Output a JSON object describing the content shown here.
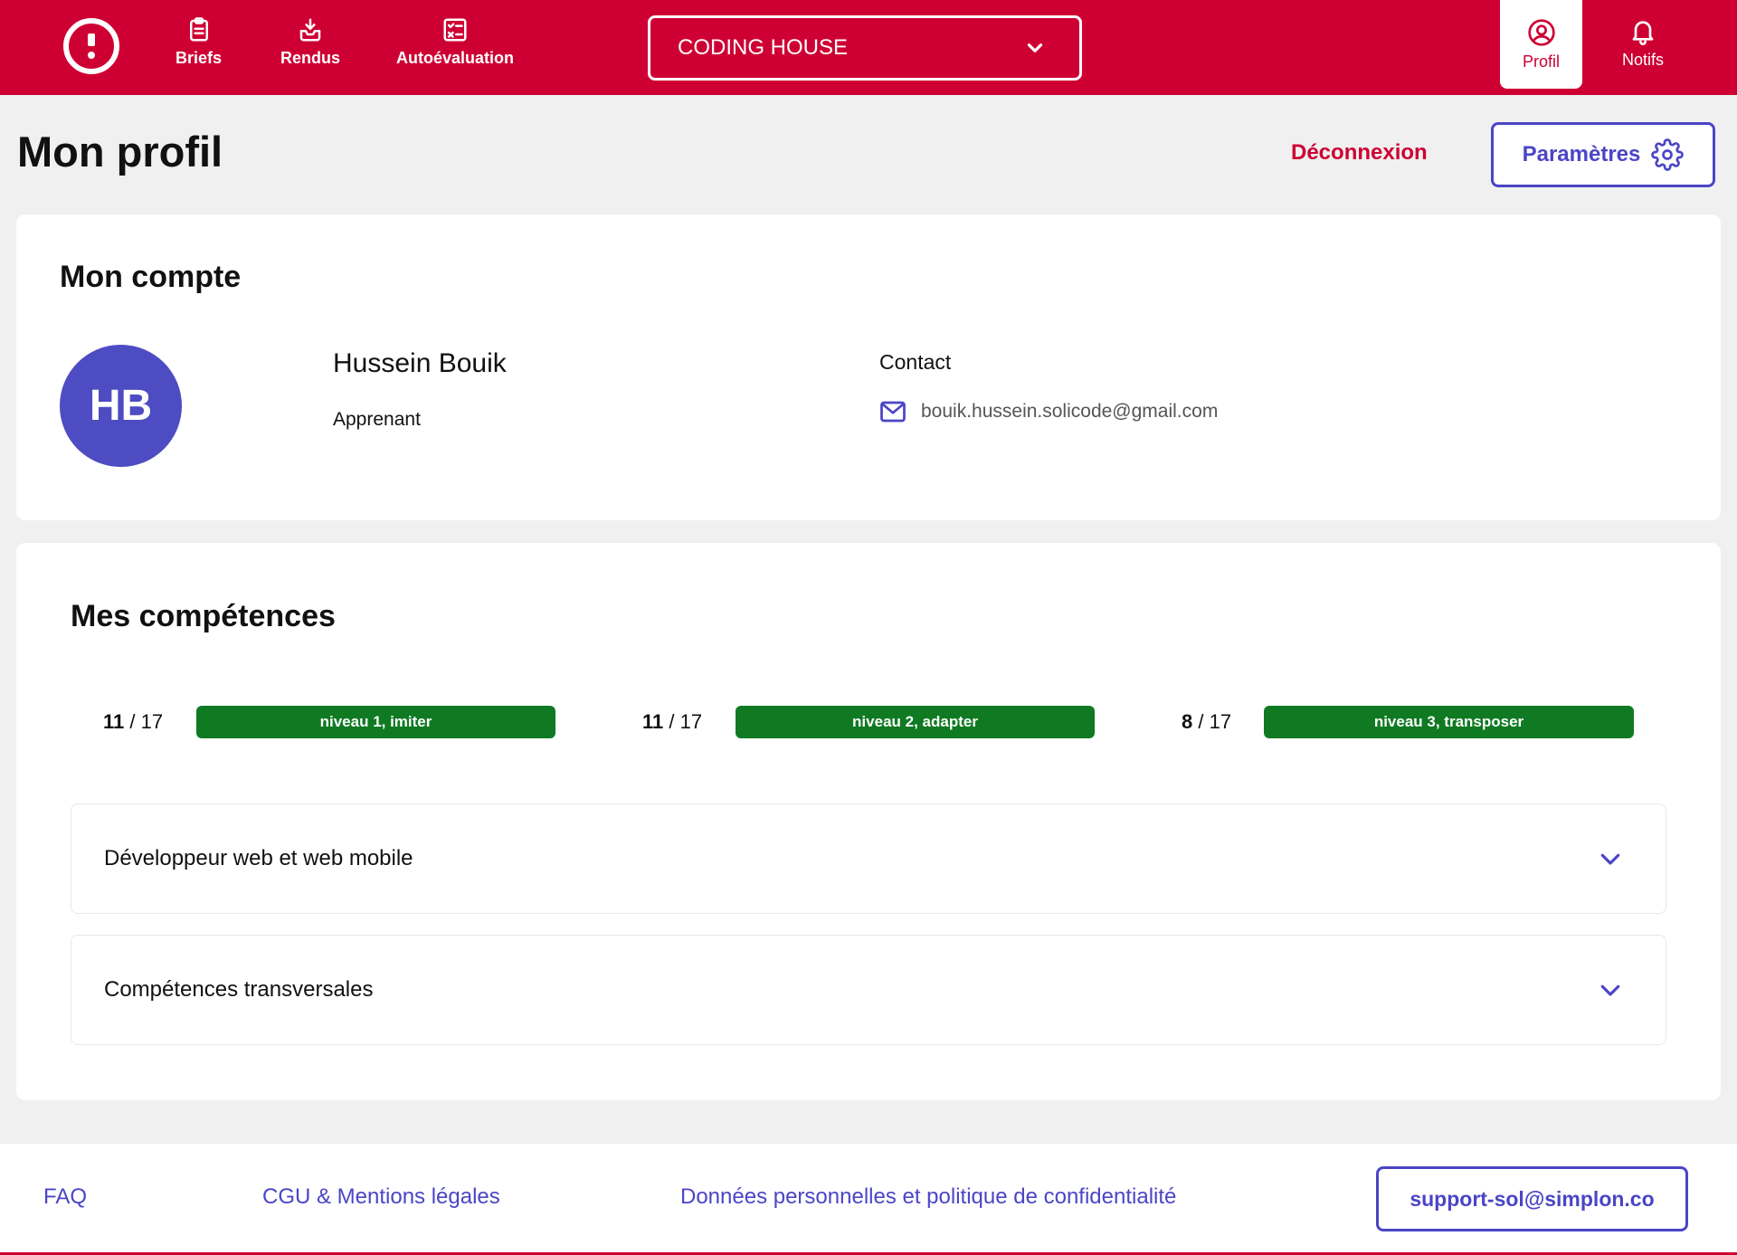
{
  "nav": {
    "briefs_label": "Briefs",
    "rendus_label": "Rendus",
    "auto_label": "Autoévaluation",
    "org_selected": "CODING HOUSE",
    "profil_label": "Profil",
    "notifs_label": "Notifs"
  },
  "header": {
    "title": "Mon profil",
    "logout_label": "Déconnexion",
    "settings_label": "Paramètres"
  },
  "account": {
    "title": "Mon compte",
    "initials": "HB",
    "name": "Hussein Bouik",
    "role": "Apprenant",
    "contact_label": "Contact",
    "email": "bouik.hussein.solicode@gmail.com"
  },
  "skills": {
    "title": "Mes compétences",
    "levels": [
      {
        "done": "11",
        "total": "/ 17",
        "label": "niveau 1, imiter"
      },
      {
        "done": "11",
        "total": "/ 17",
        "label": "niveau 2, adapter"
      },
      {
        "done": "8",
        "total": "/ 17",
        "label": "niveau 3, transposer"
      }
    ],
    "sections": [
      {
        "label": "Développeur web et web mobile"
      },
      {
        "label": "Compétences transversales"
      }
    ]
  },
  "footer": {
    "faq": "FAQ",
    "cgu": "CGU & Mentions légales",
    "data": "Données personnelles et politique de confidentialité",
    "support": "support-sol@simplon.co"
  },
  "colors": {
    "brand_red": "#ce0033",
    "accent_indigo": "#4b45c6",
    "badge_green": "#0f7a22",
    "avatar_bg": "#4e4cc2"
  }
}
